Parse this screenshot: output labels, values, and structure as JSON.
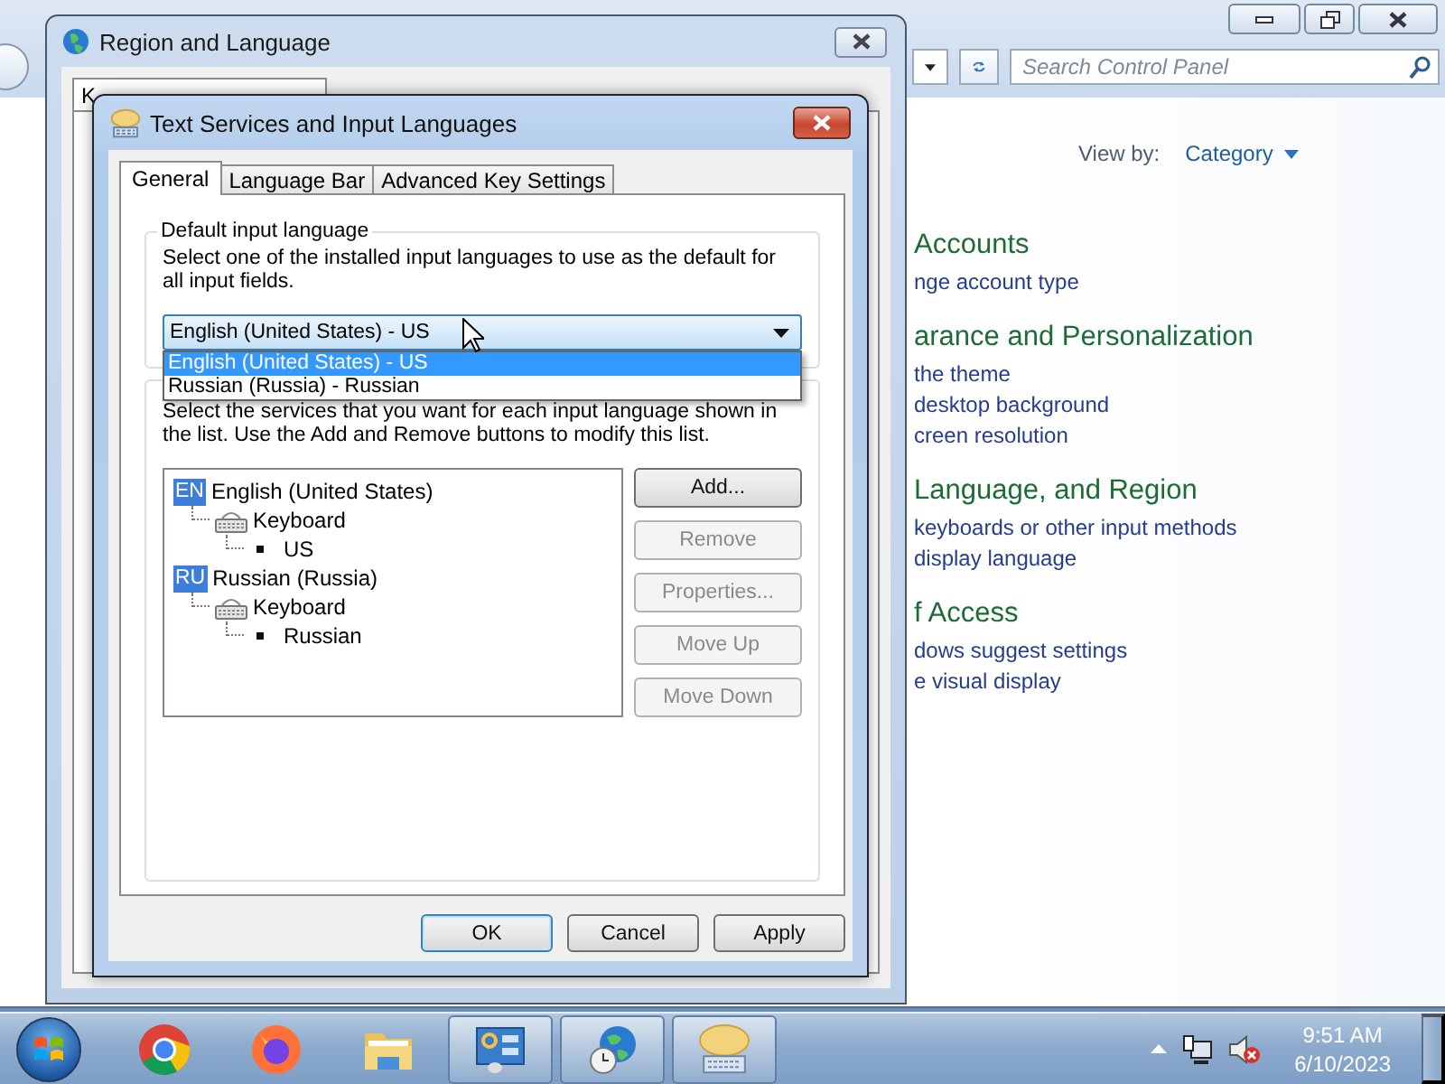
{
  "control_panel": {
    "search": {
      "placeholder": "Search Control Panel"
    },
    "view_by": {
      "label": "View by:",
      "value": "Category"
    },
    "categories": [
      {
        "title": "Accounts",
        "links": [
          "nge account type"
        ]
      },
      {
        "title": "arance and Personalization",
        "links": [
          "the theme",
          "desktop background",
          "creen resolution"
        ]
      },
      {
        "title": "Language, and Region",
        "links": [
          "keyboards or other input methods",
          "display language"
        ]
      },
      {
        "title": "f Access",
        "links": [
          "dows suggest settings",
          "e visual display"
        ]
      }
    ]
  },
  "region_window": {
    "title": "Region and Language",
    "tab": "K"
  },
  "dialog": {
    "title": "Text Services and Input Languages",
    "tabs": [
      {
        "label": "General",
        "selected": true
      },
      {
        "label": "Language Bar",
        "selected": false
      },
      {
        "label": "Advanced Key Settings",
        "selected": false
      }
    ],
    "default_input_language": {
      "heading": "Default input language",
      "description": "Select one of the installed input languages to use as the default for all input fields.",
      "value": "English (United States) - US",
      "expanded": true,
      "options": [
        {
          "label": "English (United States) - US",
          "selected": true
        },
        {
          "label": "Russian (Russia) - Russian",
          "selected": false
        }
      ]
    },
    "installed_services": {
      "description": "Select the services that you want for each input language shown in the list. Use the Add and Remove buttons to modify this list.",
      "tree": [
        {
          "kind": "language",
          "badge": "EN",
          "label": "English (United States)",
          "children": [
            {
              "kind": "keyboard",
              "label": "Keyboard",
              "children": [
                {
                  "kind": "layout",
                  "label": "US"
                }
              ]
            }
          ]
        },
        {
          "kind": "language",
          "badge": "RU",
          "label": "Russian (Russia)",
          "children": [
            {
              "kind": "keyboard",
              "label": "Keyboard",
              "children": [
                {
                  "kind": "layout",
                  "label": "Russian"
                }
              ]
            }
          ]
        }
      ],
      "buttons": [
        {
          "label": "Add...",
          "disabled": false
        },
        {
          "label": "Remove",
          "disabled": true
        },
        {
          "label": "Properties...",
          "disabled": true
        },
        {
          "label": "Move Up",
          "disabled": true
        },
        {
          "label": "Move Down",
          "disabled": true
        }
      ]
    },
    "buttons": [
      {
        "label": "OK",
        "default": true
      },
      {
        "label": "Cancel",
        "default": false
      },
      {
        "label": "Apply",
        "default": false
      }
    ]
  },
  "taskbar": {
    "apps": [
      {
        "kind": "chrome",
        "open": false
      },
      {
        "kind": "firefox",
        "open": false
      },
      {
        "kind": "explorer",
        "open": false
      },
      {
        "kind": "control_panel",
        "open": true
      },
      {
        "kind": "region",
        "open": true
      },
      {
        "kind": "text_services",
        "open": true
      }
    ],
    "clock": {
      "time": "9:51 AM",
      "date": "6/10/2023"
    }
  }
}
